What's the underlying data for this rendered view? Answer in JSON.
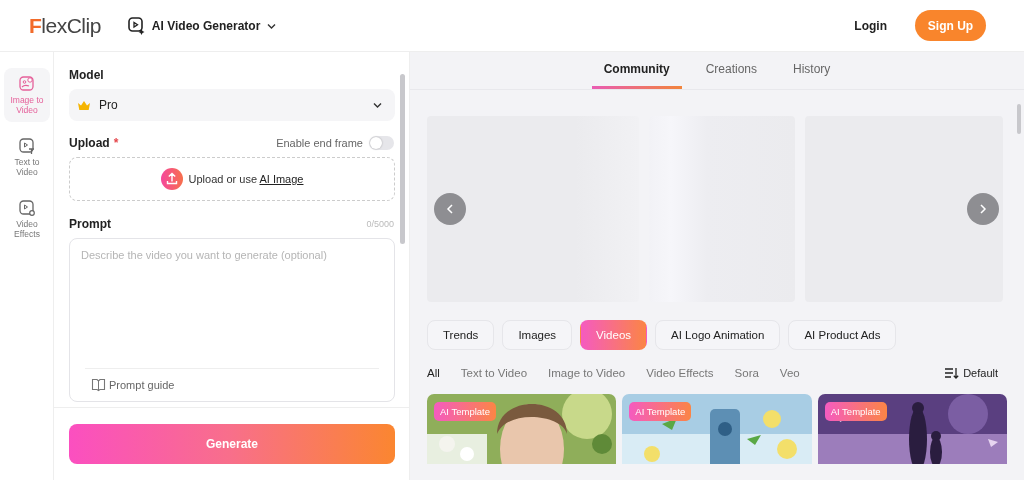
{
  "header": {
    "logo": "FlexClip",
    "product": "AI Video Generator",
    "login": "Login",
    "signup": "Sign Up"
  },
  "rail": [
    {
      "label": "Image to Video",
      "selected": true
    },
    {
      "label": "Text to Video",
      "selected": false
    },
    {
      "label": "Video Effects",
      "selected": false
    }
  ],
  "form": {
    "model_label": "Model",
    "model_value": "Pro",
    "upload_label": "Upload",
    "required_mark": "*",
    "end_frame_label": "Enable end frame",
    "end_frame_on": false,
    "upload_text": "Upload or use ",
    "upload_link": "AI Image",
    "prompt_label": "Prompt",
    "prompt_counter": "0/5000",
    "prompt_placeholder": "Describe the video you want to generate (optional)",
    "prompt_guide": "Prompt guide",
    "generate": "Generate"
  },
  "tabs": [
    {
      "label": "Community",
      "selected": true
    },
    {
      "label": "Creations",
      "selected": false
    },
    {
      "label": "History",
      "selected": false
    }
  ],
  "chips": [
    {
      "label": "Trends",
      "selected": false
    },
    {
      "label": "Images",
      "selected": false
    },
    {
      "label": "Videos",
      "selected": true
    },
    {
      "label": "AI Logo Animation",
      "selected": false
    },
    {
      "label": "AI Product Ads",
      "selected": false
    }
  ],
  "filters": [
    {
      "label": "All",
      "selected": true
    },
    {
      "label": "Text to Video",
      "selected": false
    },
    {
      "label": "Image to Video",
      "selected": false
    },
    {
      "label": "Video Effects",
      "selected": false
    },
    {
      "label": "Sora",
      "selected": false
    },
    {
      "label": "Veo",
      "selected": false
    }
  ],
  "sort": "Default",
  "cards": [
    {
      "badge": "AI Template",
      "kind": "picture"
    },
    {
      "badge": "AI Template",
      "kind": "picture"
    },
    {
      "badge": "AI Template",
      "kind": "picture"
    }
  ]
}
